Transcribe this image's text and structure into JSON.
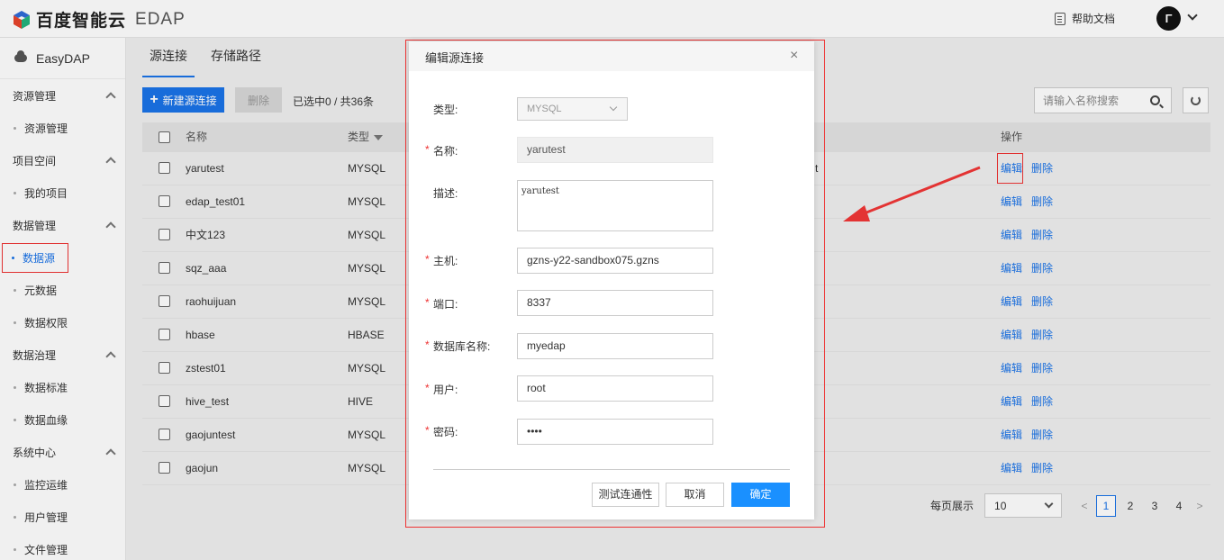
{
  "header": {
    "brand": "百度智能云",
    "product": "EDAP",
    "help": "帮助文档",
    "avatar_initial": "Γ"
  },
  "sidebar": {
    "brand": "EasyDAP",
    "groups": [
      {
        "label": "资源管理",
        "items": [
          "资源管理"
        ]
      },
      {
        "label": "项目空间",
        "items": [
          "我的项目"
        ]
      },
      {
        "label": "数据管理",
        "items": [
          "数据源",
          "元数据",
          "数据权限"
        ]
      },
      {
        "label": "数据治理",
        "items": [
          "数据标准",
          "数据血缘"
        ]
      },
      {
        "label": "系统中心",
        "items": [
          "监控运维",
          "用户管理",
          "文件管理"
        ]
      }
    ],
    "active_item": "数据源"
  },
  "main": {
    "tabs": [
      "源连接",
      "存储路径"
    ],
    "new_button": "新建源连接",
    "delete_button": "删除",
    "selection": "已选中0 / 共36条",
    "search_placeholder": "请输入名称搜索",
    "columns": {
      "name": "名称",
      "type": "类型",
      "ops": "操作"
    },
    "rows": [
      {
        "name": "yarutest",
        "type": "MYSQL"
      },
      {
        "name": "edap_test01",
        "type": "MYSQL"
      },
      {
        "name": "中文123",
        "type": "MYSQL"
      },
      {
        "name": "sqz_aaa",
        "type": "MYSQL"
      },
      {
        "name": "raohuijuan",
        "type": "MYSQL"
      },
      {
        "name": "hbase",
        "type": "HBASE"
      },
      {
        "name": "zstest01",
        "type": "MYSQL"
      },
      {
        "name": "hive_test",
        "type": "HIVE"
      },
      {
        "name": "gaojuntest",
        "type": "MYSQL"
      },
      {
        "name": "gaojun",
        "type": "MYSQL"
      }
    ],
    "row_edit": "编辑",
    "row_delete": "删除",
    "stray_text": "t",
    "pager": {
      "label": "每页展示",
      "page_size": "10",
      "prev": "<",
      "next": ">",
      "pages": [
        "1",
        "2",
        "3",
        "4"
      ],
      "current": "1"
    }
  },
  "modal": {
    "title": "编辑源连接",
    "close": "×",
    "fields": {
      "type": {
        "label": "类型:",
        "value": "MYSQL"
      },
      "name": {
        "label": "名称:",
        "value": "yarutest"
      },
      "desc": {
        "label": "描述:",
        "value": "yarutest"
      },
      "host": {
        "label": "主机:",
        "value": "gzns-y22-sandbox075.gzns"
      },
      "port": {
        "label": "端口:",
        "value": "8337"
      },
      "db": {
        "label": "数据库名称:",
        "value": "myedap"
      },
      "user": {
        "label": "用户:",
        "value": "root"
      },
      "password": {
        "label": "密码:",
        "value": "••••"
      }
    },
    "required_mark": "*",
    "buttons": {
      "test": "测试连通性",
      "cancel": "取消",
      "ok": "确定"
    }
  },
  "colors": {
    "primary": "#1a73e8",
    "annotation": "#e33333"
  }
}
